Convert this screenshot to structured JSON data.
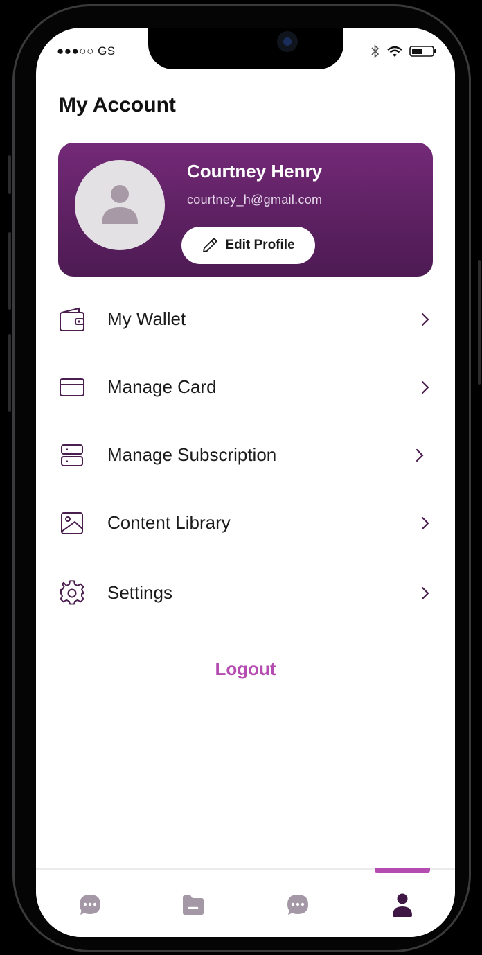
{
  "status_bar": {
    "carrier": "●●●○○ GS"
  },
  "page": {
    "title": "My Account"
  },
  "profile": {
    "name": "Courtney Henry",
    "email": "courtney_h@gmail.com",
    "edit_label": "Edit Profile"
  },
  "menu": [
    {
      "label": "My Wallet",
      "icon": "wallet-icon"
    },
    {
      "label": "Manage Card",
      "icon": "credit-card-icon"
    },
    {
      "label": "Manage Subscription",
      "icon": "server-icon"
    },
    {
      "label": "Content Library",
      "icon": "image-icon"
    },
    {
      "label": "Settings",
      "icon": "gear-icon"
    }
  ],
  "logout_label": "Logout",
  "tabbar": {
    "tabs": [
      "chat-icon",
      "folder-icon",
      "messages-icon",
      "profile-icon"
    ],
    "active_index": 3
  },
  "colors": {
    "card_gradient_top": "#742a78",
    "card_gradient_bottom": "#4e1b54",
    "accent": "#b54cb2",
    "icon_stroke": "#4a1f4f",
    "tab_inactive": "#a497a6"
  }
}
